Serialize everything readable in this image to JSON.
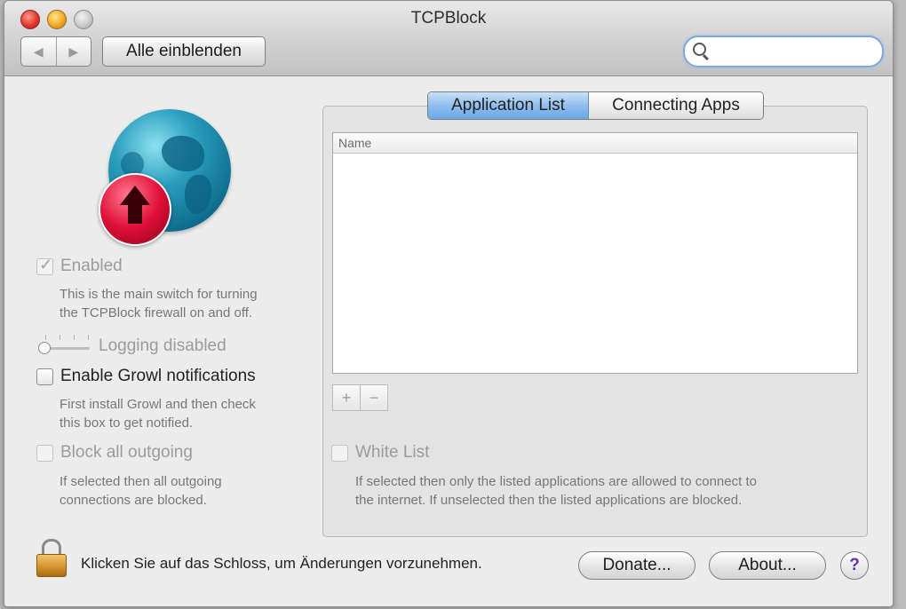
{
  "window": {
    "title": "TCPBlock"
  },
  "toolbar": {
    "back_glyph": "◀",
    "forward_glyph": "▶",
    "show_all_label": "Alle einblenden",
    "search_placeholder": ""
  },
  "left": {
    "enabled": {
      "label": "Enabled",
      "checked": true,
      "disabled": true
    },
    "enabled_desc": [
      "This is the main switch for turning",
      "the TCPBlock firewall on and off."
    ],
    "logging_label": "Logging disabled",
    "growl": {
      "label": "Enable Growl notifications",
      "checked": false
    },
    "growl_desc": [
      "First install Growl and then check",
      "this box to get notified."
    ],
    "block_outgoing": {
      "label": "Block all outgoing",
      "checked": false,
      "disabled": true
    },
    "block_desc": [
      "If selected then all outgoing",
      "connections are blocked."
    ]
  },
  "tabs": [
    {
      "label": "Application List",
      "active": true
    },
    {
      "label": "Connecting Apps",
      "active": false
    }
  ],
  "app_list": {
    "column_header": "Name",
    "rows": []
  },
  "list_buttons": {
    "add": "+",
    "remove": "−"
  },
  "whitelist": {
    "label": "White List",
    "checked": false,
    "desc": [
      "If selected then only the listed applications are allowed to connect to",
      "the internet. If unselected then the listed applications are blocked."
    ]
  },
  "footer": {
    "lock_message": "Klicken Sie auf das Schloss, um Änderungen vorzunehmen.",
    "donate_label": "Donate...",
    "about_label": "About...",
    "help_label": "?"
  },
  "colors": {
    "accent_tab": "#8cbcec",
    "help_glyph": "#6b2fb0",
    "logo_globe": "#2b9fbf",
    "logo_badge": "#e0103a"
  }
}
